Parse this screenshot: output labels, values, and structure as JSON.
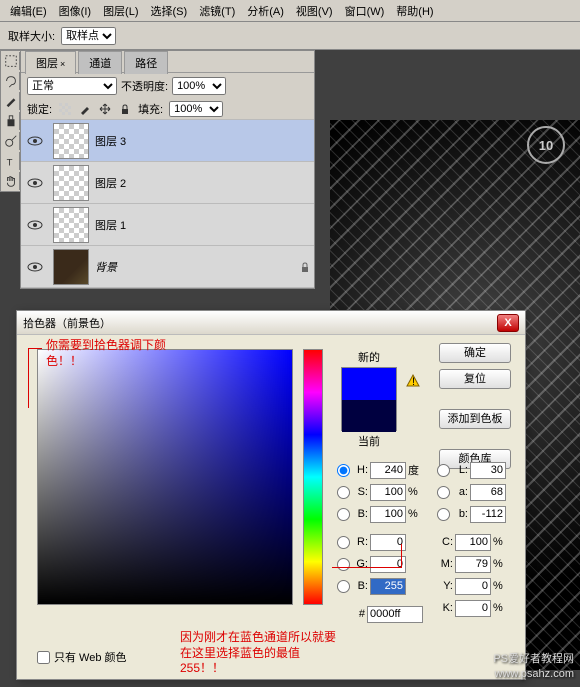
{
  "menu": [
    "编辑(E)",
    "图像(I)",
    "图层(L)",
    "选择(S)",
    "滤镜(T)",
    "分析(A)",
    "视图(V)",
    "窗口(W)",
    "帮助(H)"
  ],
  "optionsbar": {
    "sample_label": "取样大小:",
    "sample_value": "取样点"
  },
  "panel": {
    "tabs": [
      "图层",
      "通道",
      "路径"
    ],
    "active_tab": 0,
    "blend": "正常",
    "opacity_label": "不透明度:",
    "opacity_value": "100%",
    "lock_label": "锁定:",
    "fill_label": "填充:",
    "fill_value": "100%",
    "layers": [
      {
        "name": "图层 3",
        "selected": true
      },
      {
        "name": "图层 2",
        "selected": false
      },
      {
        "name": "图层 1",
        "selected": false
      },
      {
        "name": "背景",
        "selected": false,
        "bg": true
      }
    ]
  },
  "picker": {
    "title": "拾色器（前景色）",
    "new_label": "新的",
    "current_label": "当前",
    "ok": "确定",
    "cancel": "复位",
    "addswatch": "添加到色板",
    "libs": "颜色库",
    "fields": {
      "H": "240",
      "H_unit": "度",
      "S": "100",
      "S_unit": "%",
      "B_hsb": "100",
      "B_hsb_unit": "%",
      "R": "0",
      "G": "0",
      "B_rgb": "255",
      "L": "30",
      "a": "68",
      "b_lab": "-112",
      "C": "100",
      "C_unit": "%",
      "M": "79",
      "M_unit": "%",
      "Y": "0",
      "Y_unit": "%",
      "K": "0",
      "K_unit": "%",
      "hex": "0000ff"
    },
    "webonly": "只有 Web 颜色"
  },
  "annotations": {
    "a1": "你需要到拾色器调下颜色！！",
    "a2": "因为刚才在蓝色通道所以就要在这里选择蓝色的最值255！！"
  },
  "badge": "10",
  "watermark": {
    "l1": "PS爱好者教程网",
    "l2": "www.psahz.com"
  }
}
